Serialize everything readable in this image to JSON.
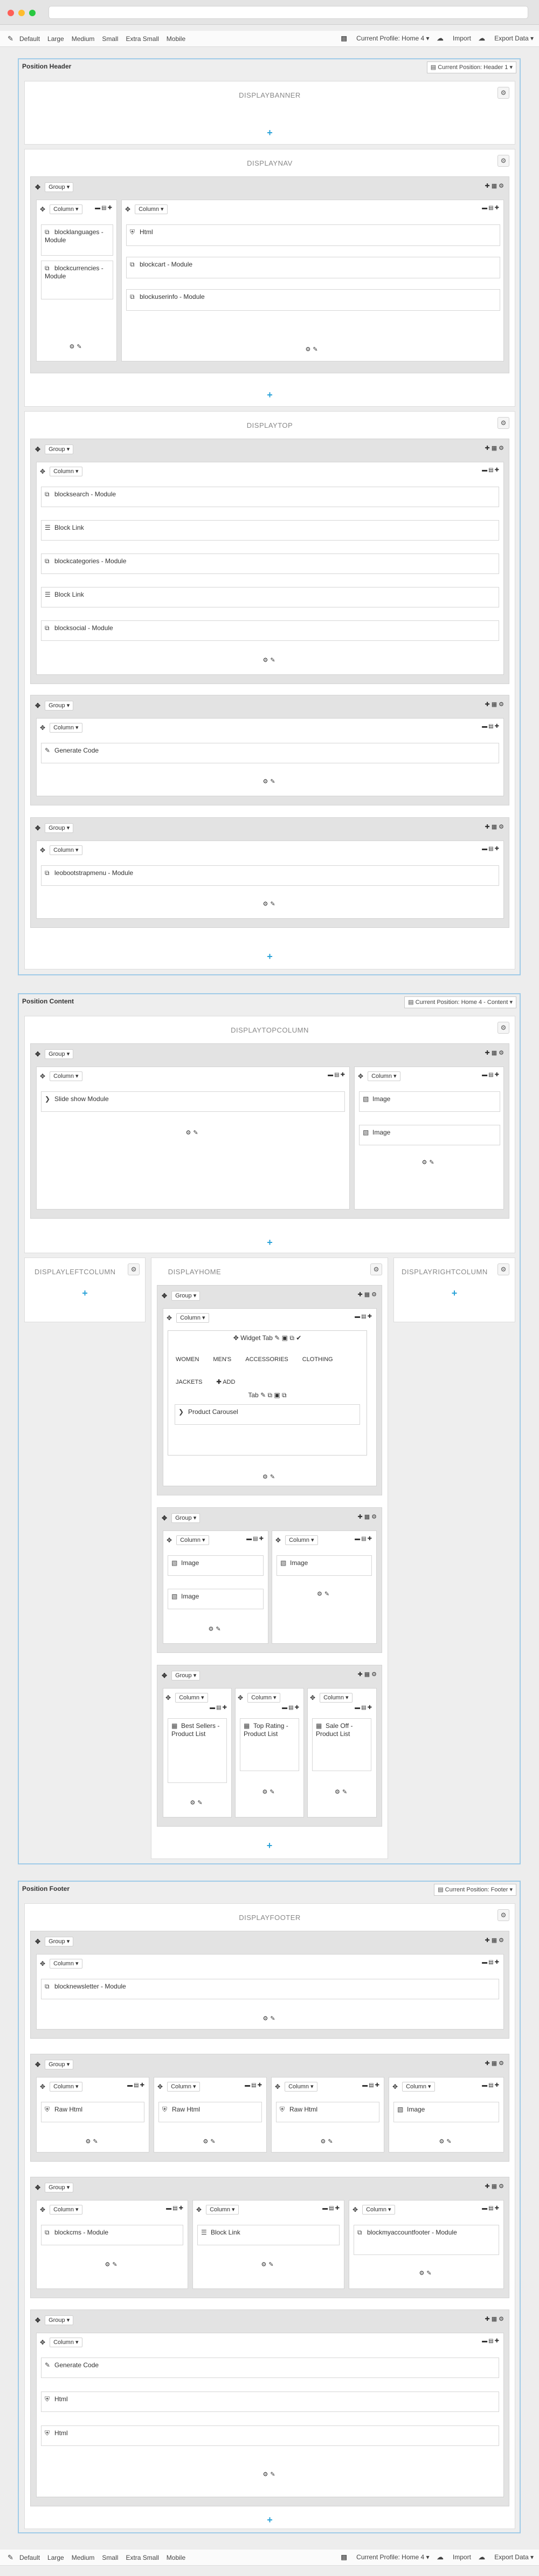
{
  "toolbar": {
    "devices": [
      "Default",
      "Large",
      "Medium",
      "Small",
      "Extra Small",
      "Mobile"
    ],
    "profile": "Current Profile: Home 4",
    "import": "Import",
    "export": "Export Data"
  },
  "header": {
    "title": "Position Header",
    "current": "Current Position: Header 1"
  },
  "content": {
    "title": "Position Content",
    "current": "Current Position: Home 4 - Content"
  },
  "footer": {
    "title": "Position Footer",
    "current": "Current Position: Footer"
  },
  "labels": {
    "group": "Group",
    "column": "Column"
  },
  "hooks": {
    "banner": "DISPLAYBANNER",
    "nav": "DISPLAYNAV",
    "top": "DISPLAYTOP",
    "topcolumn": "DISPLAYTOPCOLUMN",
    "left": "DISPLAYLEFTCOLUMN",
    "home": "DISPLAYHOME",
    "right": "DISPLAYRIGHTCOLUMN",
    "footer": "DISPLAYFOOTER"
  },
  "modules": {
    "blocklanguages": "blocklanguages - Module",
    "blockcurrencies": "blockcurrencies - Module",
    "html": "Html",
    "blockcart": "blockcart - Module",
    "blockuserinfo": "blockuserinfo - Module",
    "blocksearch": "blocksearch - Module",
    "blocklink": "Block Link",
    "blockcategories": "blockcategories - Module",
    "blocksocial": "blocksocial - Module",
    "generatecode": "Generate Code",
    "leobootstrapmenu": "leobootstrapmenu - Module",
    "slideshow": "Slide show Module",
    "image": "Image",
    "widgettab": "Widget Tab",
    "tab": "Tab",
    "add": "ADD",
    "productcarousel": "Product Carousel",
    "bestsellers": "Best Sellers - Product List",
    "toprating": "Top Rating - Product List",
    "saleoff": "Sale Off - Product List",
    "blocknewsletter": "blocknewsletter - Module",
    "rawhtml": "Raw Html",
    "blockcms": "blockcms - Module",
    "blockmyaccountfooter": "blockmyaccountfooter - Module"
  },
  "tabs": [
    "WOMEN",
    "MEN'S",
    "ACCESSORIES",
    "CLOTHING",
    "JACKETS"
  ]
}
